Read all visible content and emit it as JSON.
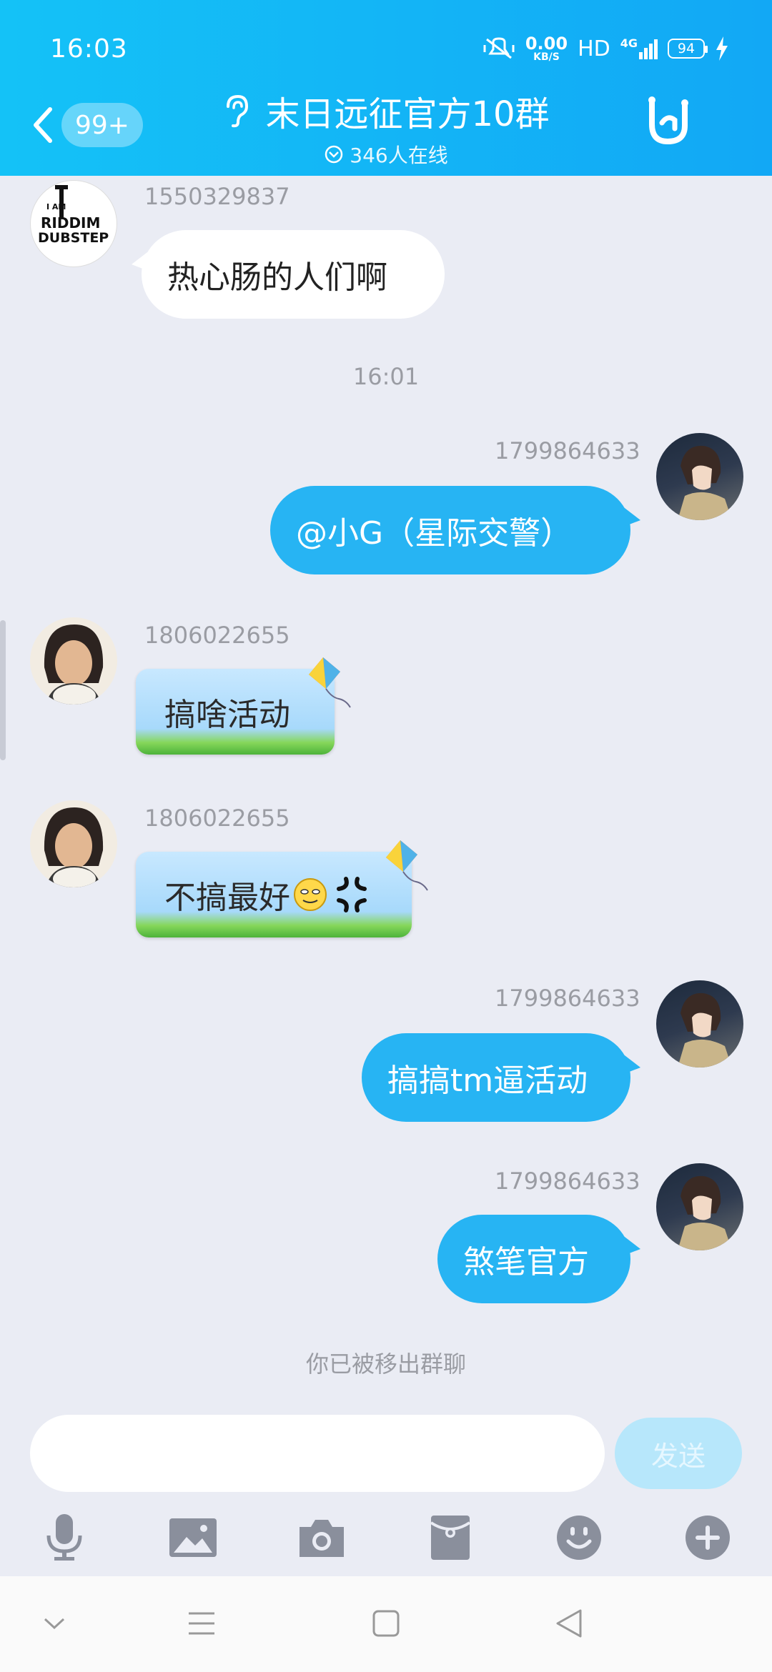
{
  "status": {
    "time": "16:03",
    "net_speed": "0.00",
    "net_unit": "KB/S",
    "hd": "HD",
    "net_type": "4G",
    "battery": "94"
  },
  "header": {
    "back_badge": "99+",
    "title": "末日远征官方10群",
    "online": "346人在线"
  },
  "messages": [
    {
      "sender": "1550329837",
      "text": "热心肠的人们啊"
    },
    {
      "timestamp": "16:01"
    },
    {
      "sender": "1799864633",
      "text": "@小G（星际交警）"
    },
    {
      "sender": "1806022655",
      "text": "搞啥活动"
    },
    {
      "sender": "1806022655",
      "text": "不搞最好"
    },
    {
      "sender": "1799864633",
      "text": "搞搞tm逼活动"
    },
    {
      "sender": "1799864633",
      "text": "煞笔官方"
    }
  ],
  "avatar_logo": {
    "line1": "I AM",
    "line2": "RIDDIM",
    "line3": "DUBSTEP"
  },
  "system_notice": "你已被移出群聊",
  "composer": {
    "send_label": "发送",
    "placeholder": ""
  },
  "colors": {
    "header": "#14c2f7",
    "out_bubble": "#27b4f3",
    "background": "#eaecf4"
  },
  "toolbar_icons": [
    "microphone-icon",
    "image-icon",
    "camera-icon",
    "red-packet-icon",
    "emoji-icon",
    "plus-icon"
  ],
  "nav_icons": [
    "chevron-down-icon",
    "menu-icon",
    "home-square-icon",
    "back-triangle-icon"
  ]
}
